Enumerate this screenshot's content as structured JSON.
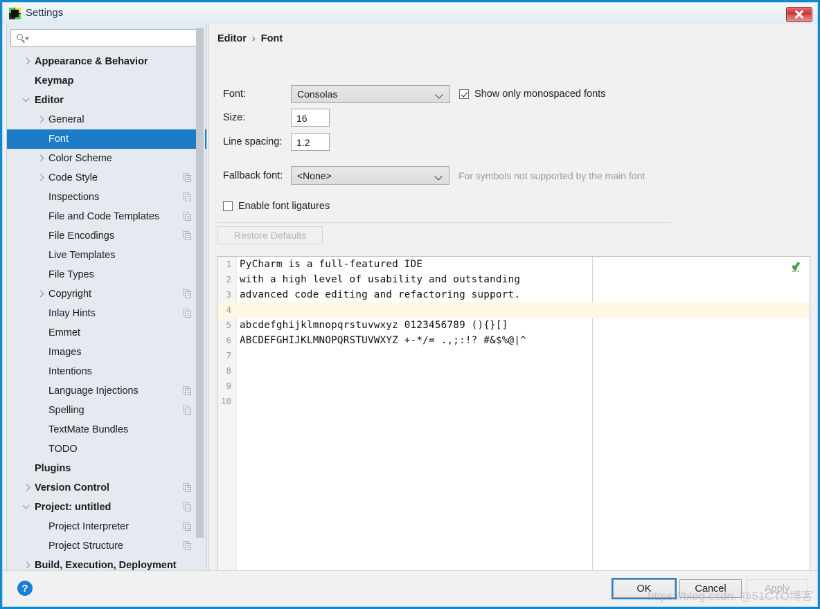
{
  "window": {
    "title": "Settings",
    "icon": "pycharm-icon",
    "close_label": "close-icon"
  },
  "search": {
    "value": "",
    "placeholder": ""
  },
  "sidebar": {
    "items": [
      {
        "label": "Appearance & Behavior",
        "indent": 0,
        "arrow": "right",
        "bold": true,
        "copy": false,
        "selected": false
      },
      {
        "label": "Keymap",
        "indent": 0,
        "arrow": "none",
        "bold": true,
        "copy": false,
        "selected": false
      },
      {
        "label": "Editor",
        "indent": 0,
        "arrow": "down",
        "bold": true,
        "copy": false,
        "selected": false
      },
      {
        "label": "General",
        "indent": 1,
        "arrow": "right",
        "bold": false,
        "copy": false,
        "selected": false
      },
      {
        "label": "Font",
        "indent": 1,
        "arrow": "none",
        "bold": false,
        "copy": false,
        "selected": true
      },
      {
        "label": "Color Scheme",
        "indent": 1,
        "arrow": "right",
        "bold": false,
        "copy": false,
        "selected": false
      },
      {
        "label": "Code Style",
        "indent": 1,
        "arrow": "right",
        "bold": false,
        "copy": true,
        "selected": false
      },
      {
        "label": "Inspections",
        "indent": 1,
        "arrow": "none",
        "bold": false,
        "copy": true,
        "selected": false
      },
      {
        "label": "File and Code Templates",
        "indent": 1,
        "arrow": "none",
        "bold": false,
        "copy": true,
        "selected": false
      },
      {
        "label": "File Encodings",
        "indent": 1,
        "arrow": "none",
        "bold": false,
        "copy": true,
        "selected": false
      },
      {
        "label": "Live Templates",
        "indent": 1,
        "arrow": "none",
        "bold": false,
        "copy": false,
        "selected": false
      },
      {
        "label": "File Types",
        "indent": 1,
        "arrow": "none",
        "bold": false,
        "copy": false,
        "selected": false
      },
      {
        "label": "Copyright",
        "indent": 1,
        "arrow": "right",
        "bold": false,
        "copy": true,
        "selected": false
      },
      {
        "label": "Inlay Hints",
        "indent": 1,
        "arrow": "none",
        "bold": false,
        "copy": true,
        "selected": false
      },
      {
        "label": "Emmet",
        "indent": 1,
        "arrow": "none",
        "bold": false,
        "copy": false,
        "selected": false
      },
      {
        "label": "Images",
        "indent": 1,
        "arrow": "none",
        "bold": false,
        "copy": false,
        "selected": false
      },
      {
        "label": "Intentions",
        "indent": 1,
        "arrow": "none",
        "bold": false,
        "copy": false,
        "selected": false
      },
      {
        "label": "Language Injections",
        "indent": 1,
        "arrow": "none",
        "bold": false,
        "copy": true,
        "selected": false
      },
      {
        "label": "Spelling",
        "indent": 1,
        "arrow": "none",
        "bold": false,
        "copy": true,
        "selected": false
      },
      {
        "label": "TextMate Bundles",
        "indent": 1,
        "arrow": "none",
        "bold": false,
        "copy": false,
        "selected": false
      },
      {
        "label": "TODO",
        "indent": 1,
        "arrow": "none",
        "bold": false,
        "copy": false,
        "selected": false
      },
      {
        "label": "Plugins",
        "indent": 0,
        "arrow": "none",
        "bold": true,
        "copy": false,
        "selected": false
      },
      {
        "label": "Version Control",
        "indent": 0,
        "arrow": "right",
        "bold": true,
        "copy": true,
        "selected": false
      },
      {
        "label": "Project: untitled",
        "indent": 0,
        "arrow": "down",
        "bold": true,
        "copy": true,
        "selected": false
      },
      {
        "label": "Project Interpreter",
        "indent": 1,
        "arrow": "none",
        "bold": false,
        "copy": true,
        "selected": false
      },
      {
        "label": "Project Structure",
        "indent": 1,
        "arrow": "none",
        "bold": false,
        "copy": true,
        "selected": false
      },
      {
        "label": "Build, Execution, Deployment",
        "indent": 0,
        "arrow": "right",
        "bold": true,
        "copy": false,
        "selected": false
      }
    ]
  },
  "main": {
    "breadcrumb_root": "Editor",
    "breadcrumb_sep": "›",
    "breadcrumb_leaf": "Font",
    "font_label": "Font:",
    "font_value": "Consolas",
    "monospaced_label": "Show only monospaced fonts",
    "monospaced_checked": true,
    "size_label": "Size:",
    "size_value": "16",
    "line_spacing_label": "Line spacing:",
    "line_spacing_value": "1.2",
    "fallback_label": "Fallback font:",
    "fallback_value": "<None>",
    "fallback_hint": "For symbols not supported by the main font",
    "ligatures_label": "Enable font ligatures",
    "ligatures_checked": false,
    "restore_defaults_label": "Restore Defaults"
  },
  "preview": {
    "lines": [
      {
        "n": "1",
        "text": "PyCharm is a full-featured IDE",
        "highlight": false
      },
      {
        "n": "2",
        "text": "with a high level of usability and outstanding",
        "highlight": false
      },
      {
        "n": "3",
        "text": "advanced code editing and refactoring support.",
        "highlight": false
      },
      {
        "n": "4",
        "text": "",
        "highlight": true
      },
      {
        "n": "5",
        "text": "abcdefghijklmnopqrstuvwxyz 0123456789 (){}[]",
        "highlight": false
      },
      {
        "n": "6",
        "text": "ABCDEFGHIJKLMNOPQRSTUVWXYZ +-*/= .,;:!? #&$%@|^",
        "highlight": false
      },
      {
        "n": "7",
        "text": "",
        "highlight": false
      },
      {
        "n": "8",
        "text": "",
        "highlight": false
      },
      {
        "n": "9",
        "text": "",
        "highlight": false
      },
      {
        "n": "10",
        "text": "",
        "highlight": false
      }
    ],
    "inspection_status": "ok-checkmark"
  },
  "footer": {
    "help_label": "?",
    "ok_label": "OK",
    "cancel_label": "Cancel",
    "apply_label": "Apply",
    "apply_enabled": false,
    "watermark": "https://blog.csdn.    @51CTO博客"
  },
  "colors": {
    "selection_blue": "#1e7bc8",
    "accent_blue": "#1c7fd6",
    "sidebar_bg": "#e4eaf0",
    "panel_bg": "#f1f1f1",
    "highlight_line": "#fdf7e3",
    "ok_green": "#4aa24a",
    "close_red": "#c63030"
  }
}
